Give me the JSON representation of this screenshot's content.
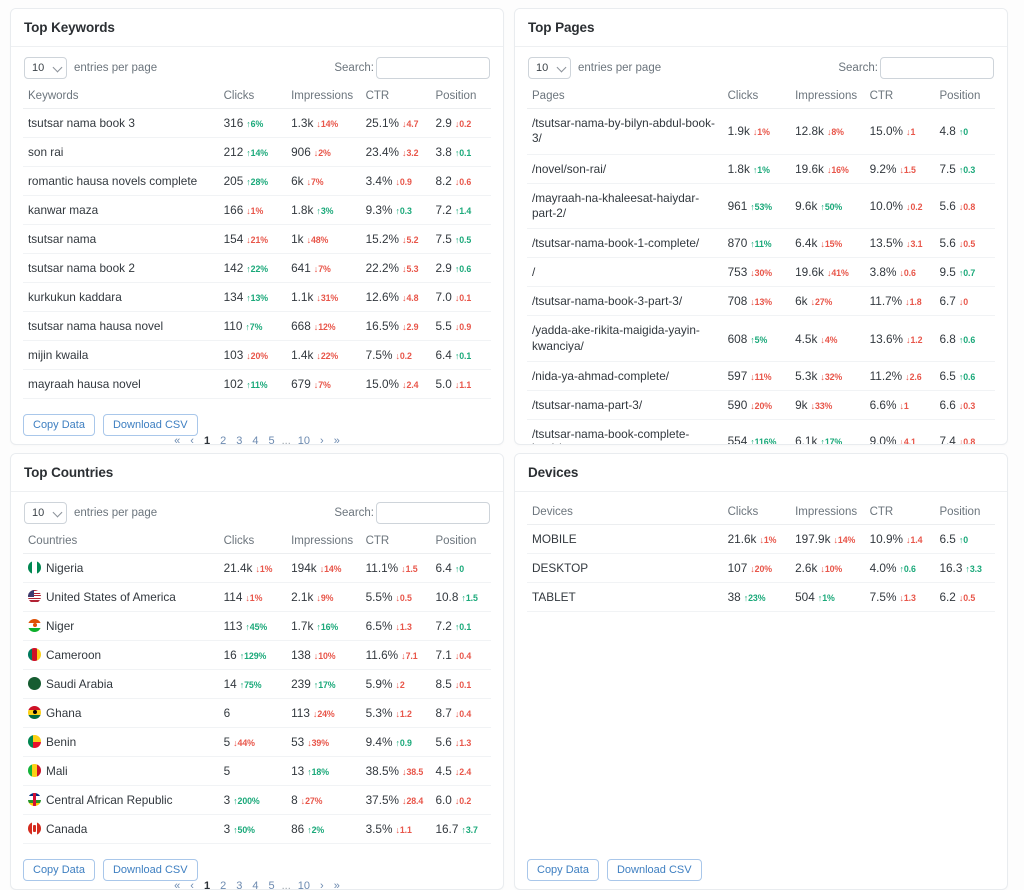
{
  "common": {
    "entries_label": "entries per page",
    "search_label": "Search:",
    "search_placeholder": "",
    "entries_value": "10",
    "entries_options": [
      "10",
      "25",
      "50",
      "100"
    ],
    "copy_label": "Copy Data",
    "download_label": "Download CSV",
    "pagination": [
      "«",
      "‹",
      "1",
      "2",
      "3",
      "4",
      "5",
      "...",
      "10",
      "›",
      "»"
    ],
    "pagination_active": "1",
    "colors": {
      "up": "#1ba97a",
      "down": "#e8564a",
      "link": "#3e7fc1",
      "text": "#32383e",
      "muted": "#6c757d",
      "border": "#e9ecef"
    }
  },
  "keywords_panel": {
    "title": "Top Keywords",
    "columns": [
      "Keywords",
      "Clicks",
      "Impressions",
      "CTR",
      "Position"
    ],
    "rows": [
      {
        "name": "tsutsar nama book 3",
        "clicks": "316",
        "clicks_d": "6%",
        "clicks_dir": "up",
        "impr": "1.3k",
        "impr_d": "14%",
        "impr_dir": "down",
        "ctr": "25.1%",
        "ctr_d": "4.7",
        "ctr_dir": "down",
        "pos": "2.9",
        "pos_d": "0.2",
        "pos_dir": "down"
      },
      {
        "name": "son rai",
        "clicks": "212",
        "clicks_d": "14%",
        "clicks_dir": "up",
        "impr": "906",
        "impr_d": "2%",
        "impr_dir": "down",
        "ctr": "23.4%",
        "ctr_d": "3.2",
        "ctr_dir": "down",
        "pos": "3.8",
        "pos_d": "0.1",
        "pos_dir": "up"
      },
      {
        "name": "romantic hausa novels complete",
        "clicks": "205",
        "clicks_d": "28%",
        "clicks_dir": "up",
        "impr": "6k",
        "impr_d": "7%",
        "impr_dir": "down",
        "ctr": "3.4%",
        "ctr_d": "0.9",
        "ctr_dir": "down",
        "pos": "8.2",
        "pos_d": "0.6",
        "pos_dir": "down"
      },
      {
        "name": "kanwar maza",
        "clicks": "166",
        "clicks_d": "1%",
        "clicks_dir": "down",
        "impr": "1.8k",
        "impr_d": "3%",
        "impr_dir": "up",
        "ctr": "9.3%",
        "ctr_d": "0.3",
        "ctr_dir": "up",
        "pos": "7.2",
        "pos_d": "1.4",
        "pos_dir": "up"
      },
      {
        "name": "tsutsar nama",
        "clicks": "154",
        "clicks_d": "21%",
        "clicks_dir": "down",
        "impr": "1k",
        "impr_d": "48%",
        "impr_dir": "down",
        "ctr": "15.2%",
        "ctr_d": "5.2",
        "ctr_dir": "down",
        "pos": "7.5",
        "pos_d": "0.5",
        "pos_dir": "up"
      },
      {
        "name": "tsutsar nama book 2",
        "clicks": "142",
        "clicks_d": "22%",
        "clicks_dir": "up",
        "impr": "641",
        "impr_d": "7%",
        "impr_dir": "down",
        "ctr": "22.2%",
        "ctr_d": "5.3",
        "ctr_dir": "down",
        "pos": "2.9",
        "pos_d": "0.6",
        "pos_dir": "up"
      },
      {
        "name": "kurkukun kaddara",
        "clicks": "134",
        "clicks_d": "13%",
        "clicks_dir": "up",
        "impr": "1.1k",
        "impr_d": "31%",
        "impr_dir": "down",
        "ctr": "12.6%",
        "ctr_d": "4.8",
        "ctr_dir": "down",
        "pos": "7.0",
        "pos_d": "0.1",
        "pos_dir": "down"
      },
      {
        "name": "tsutsar nama hausa novel",
        "clicks": "110",
        "clicks_d": "7%",
        "clicks_dir": "up",
        "impr": "668",
        "impr_d": "12%",
        "impr_dir": "down",
        "ctr": "16.5%",
        "ctr_d": "2.9",
        "ctr_dir": "down",
        "pos": "5.5",
        "pos_d": "0.9",
        "pos_dir": "down"
      },
      {
        "name": "mijin kwaila",
        "clicks": "103",
        "clicks_d": "20%",
        "clicks_dir": "down",
        "impr": "1.4k",
        "impr_d": "22%",
        "impr_dir": "down",
        "ctr": "7.5%",
        "ctr_d": "0.2",
        "ctr_dir": "down",
        "pos": "6.4",
        "pos_d": "0.1",
        "pos_dir": "up"
      },
      {
        "name": "mayraah hausa novel",
        "clicks": "102",
        "clicks_d": "11%",
        "clicks_dir": "up",
        "impr": "679",
        "impr_d": "7%",
        "impr_dir": "down",
        "ctr": "15.0%",
        "ctr_d": "2.4",
        "ctr_dir": "down",
        "pos": "5.0",
        "pos_d": "1.1",
        "pos_dir": "down"
      }
    ]
  },
  "pages_panel": {
    "title": "Top Pages",
    "columns": [
      "Pages",
      "Clicks",
      "Impressions",
      "CTR",
      "Position"
    ],
    "rows": [
      {
        "name": "/tsutsar-nama-by-bilyn-abdul-book-3/",
        "clicks": "1.9k",
        "clicks_d": "1%",
        "clicks_dir": "down",
        "impr": "12.8k",
        "impr_d": "8%",
        "impr_dir": "down",
        "ctr": "15.0%",
        "ctr_d": "1",
        "ctr_dir": "down",
        "pos": "4.8",
        "pos_d": "0",
        "pos_dir": "up"
      },
      {
        "name": "/novel/son-rai/",
        "clicks": "1.8k",
        "clicks_d": "1%",
        "clicks_dir": "up",
        "impr": "19.6k",
        "impr_d": "16%",
        "impr_dir": "down",
        "ctr": "9.2%",
        "ctr_d": "1.5",
        "ctr_dir": "down",
        "pos": "7.5",
        "pos_d": "0.3",
        "pos_dir": "up"
      },
      {
        "name": "/mayraah-na-khaleesat-haiydar-part-2/",
        "clicks": "961",
        "clicks_d": "53%",
        "clicks_dir": "up",
        "impr": "9.6k",
        "impr_d": "50%",
        "impr_dir": "up",
        "ctr": "10.0%",
        "ctr_d": "0.2",
        "ctr_dir": "down",
        "pos": "5.6",
        "pos_d": "0.8",
        "pos_dir": "down"
      },
      {
        "name": "/tsutsar-nama-book-1-complete/",
        "clicks": "870",
        "clicks_d": "11%",
        "clicks_dir": "up",
        "impr": "6.4k",
        "impr_d": "15%",
        "impr_dir": "down",
        "ctr": "13.5%",
        "ctr_d": "3.1",
        "ctr_dir": "down",
        "pos": "5.6",
        "pos_d": "0.5",
        "pos_dir": "down"
      },
      {
        "name": "/",
        "clicks": "753",
        "clicks_d": "30%",
        "clicks_dir": "down",
        "impr": "19.6k",
        "impr_d": "41%",
        "impr_dir": "down",
        "ctr": "3.8%",
        "ctr_d": "0.6",
        "ctr_dir": "down",
        "pos": "9.5",
        "pos_d": "0.7",
        "pos_dir": "up"
      },
      {
        "name": "/tsutsar-nama-book-3-part-3/",
        "clicks": "708",
        "clicks_d": "13%",
        "clicks_dir": "down",
        "impr": "6k",
        "impr_d": "27%",
        "impr_dir": "down",
        "ctr": "11.7%",
        "ctr_d": "1.8",
        "ctr_dir": "down",
        "pos": "6.7",
        "pos_d": "0",
        "pos_dir": "down"
      },
      {
        "name": "/yadda-ake-rikita-maigida-yayin-kwanciya/",
        "clicks": "608",
        "clicks_d": "5%",
        "clicks_dir": "up",
        "impr": "4.5k",
        "impr_d": "4%",
        "impr_dir": "down",
        "ctr": "13.6%",
        "ctr_d": "1.2",
        "ctr_dir": "down",
        "pos": "6.8",
        "pos_d": "0.6",
        "pos_dir": "up"
      },
      {
        "name": "/nida-ya-ahmad-complete/",
        "clicks": "597",
        "clicks_d": "11%",
        "clicks_dir": "down",
        "impr": "5.3k",
        "impr_d": "32%",
        "impr_dir": "down",
        "ctr": "11.2%",
        "ctr_d": "2.6",
        "ctr_dir": "down",
        "pos": "6.5",
        "pos_d": "0.6",
        "pos_dir": "up"
      },
      {
        "name": "/tsutsar-nama-part-3/",
        "clicks": "590",
        "clicks_d": "20%",
        "clicks_dir": "down",
        "impr": "9k",
        "impr_d": "33%",
        "impr_dir": "down",
        "ctr": "6.6%",
        "ctr_d": "1",
        "ctr_dir": "down",
        "pos": "6.6",
        "pos_d": "0.3",
        "pos_dir": "down"
      },
      {
        "name": "/tsutsar-nama-book-complete-book/",
        "clicks": "554",
        "clicks_d": "116%",
        "clicks_dir": "up",
        "impr": "6.1k",
        "impr_d": "17%",
        "impr_dir": "up",
        "ctr": "9.0%",
        "ctr_d": "4.1",
        "ctr_dir": "down",
        "pos": "7.4",
        "pos_d": "0.8",
        "pos_dir": "down"
      }
    ]
  },
  "countries_panel": {
    "title": "Top Countries",
    "columns": [
      "Countries",
      "Clicks",
      "Impressions",
      "CTR",
      "Position"
    ],
    "rows": [
      {
        "name": "Nigeria",
        "flag": "flag-nigeria",
        "clicks": "21.4k",
        "clicks_d": "1%",
        "clicks_dir": "down",
        "impr": "194k",
        "impr_d": "14%",
        "impr_dir": "down",
        "ctr": "11.1%",
        "ctr_d": "1.5",
        "ctr_dir": "down",
        "pos": "6.4",
        "pos_d": "0",
        "pos_dir": "up"
      },
      {
        "name": "United States of America",
        "flag": "flag-usa",
        "clicks": "114",
        "clicks_d": "1%",
        "clicks_dir": "down",
        "impr": "2.1k",
        "impr_d": "9%",
        "impr_dir": "down",
        "ctr": "5.5%",
        "ctr_d": "0.5",
        "ctr_dir": "down",
        "pos": "10.8",
        "pos_d": "1.5",
        "pos_dir": "up"
      },
      {
        "name": "Niger",
        "flag": "flag-niger",
        "clicks": "113",
        "clicks_d": "45%",
        "clicks_dir": "up",
        "impr": "1.7k",
        "impr_d": "16%",
        "impr_dir": "up",
        "ctr": "6.5%",
        "ctr_d": "1.3",
        "ctr_dir": "down",
        "pos": "7.2",
        "pos_d": "0.1",
        "pos_dir": "up"
      },
      {
        "name": "Cameroon",
        "flag": "flag-cameroon",
        "clicks": "16",
        "clicks_d": "129%",
        "clicks_dir": "up",
        "impr": "138",
        "impr_d": "10%",
        "impr_dir": "down",
        "ctr": "11.6%",
        "ctr_d": "7.1",
        "ctr_dir": "down",
        "pos": "7.1",
        "pos_d": "0.4",
        "pos_dir": "down"
      },
      {
        "name": "Saudi Arabia",
        "flag": "flag-saudi-arabia",
        "clicks": "14",
        "clicks_d": "75%",
        "clicks_dir": "up",
        "impr": "239",
        "impr_d": "17%",
        "impr_dir": "up",
        "ctr": "5.9%",
        "ctr_d": "2",
        "ctr_dir": "down",
        "pos": "8.5",
        "pos_d": "0.1",
        "pos_dir": "down"
      },
      {
        "name": "Ghana",
        "flag": "flag-ghana",
        "clicks": "6",
        "clicks_d": "",
        "clicks_dir": "",
        "impr": "113",
        "impr_d": "24%",
        "impr_dir": "down",
        "ctr": "5.3%",
        "ctr_d": "1.2",
        "ctr_dir": "down",
        "pos": "8.7",
        "pos_d": "0.4",
        "pos_dir": "down"
      },
      {
        "name": "Benin",
        "flag": "flag-benin",
        "clicks": "5",
        "clicks_d": "44%",
        "clicks_dir": "down",
        "impr": "53",
        "impr_d": "39%",
        "impr_dir": "down",
        "ctr": "9.4%",
        "ctr_d": "0.9",
        "ctr_dir": "up",
        "pos": "5.6",
        "pos_d": "1.3",
        "pos_dir": "down"
      },
      {
        "name": "Mali",
        "flag": "flag-mali",
        "clicks": "5",
        "clicks_d": "",
        "clicks_dir": "",
        "impr": "13",
        "impr_d": "18%",
        "impr_dir": "up",
        "ctr": "38.5%",
        "ctr_d": "38.5",
        "ctr_dir": "down",
        "pos": "4.5",
        "pos_d": "2.4",
        "pos_dir": "down"
      },
      {
        "name": "Central African Republic",
        "flag": "flag-central-african-republic",
        "clicks": "3",
        "clicks_d": "200%",
        "clicks_dir": "up",
        "impr": "8",
        "impr_d": "27%",
        "impr_dir": "down",
        "ctr": "37.5%",
        "ctr_d": "28.4",
        "ctr_dir": "down",
        "pos": "6.0",
        "pos_d": "0.2",
        "pos_dir": "down"
      },
      {
        "name": "Canada",
        "flag": "flag-canada",
        "clicks": "3",
        "clicks_d": "50%",
        "clicks_dir": "up",
        "impr": "86",
        "impr_d": "2%",
        "impr_dir": "up",
        "ctr": "3.5%",
        "ctr_d": "1.1",
        "ctr_dir": "down",
        "pos": "16.7",
        "pos_d": "3.7",
        "pos_dir": "up"
      }
    ]
  },
  "devices_panel": {
    "title": "Devices",
    "columns": [
      "Devices",
      "Clicks",
      "Impressions",
      "CTR",
      "Position"
    ],
    "rows": [
      {
        "name": "MOBILE",
        "clicks": "21.6k",
        "clicks_d": "1%",
        "clicks_dir": "down",
        "impr": "197.9k",
        "impr_d": "14%",
        "impr_dir": "down",
        "ctr": "10.9%",
        "ctr_d": "1.4",
        "ctr_dir": "down",
        "pos": "6.5",
        "pos_d": "0",
        "pos_dir": "up"
      },
      {
        "name": "DESKTOP",
        "clicks": "107",
        "clicks_d": "20%",
        "clicks_dir": "down",
        "impr": "2.6k",
        "impr_d": "10%",
        "impr_dir": "down",
        "ctr": "4.0%",
        "ctr_d": "0.6",
        "ctr_dir": "up",
        "pos": "16.3",
        "pos_d": "3.3",
        "pos_dir": "up"
      },
      {
        "name": "TABLET",
        "clicks": "38",
        "clicks_d": "23%",
        "clicks_dir": "up",
        "impr": "504",
        "impr_d": "1%",
        "impr_dir": "up",
        "ctr": "7.5%",
        "ctr_d": "1.3",
        "ctr_dir": "down",
        "pos": "6.2",
        "pos_d": "0.5",
        "pos_dir": "down"
      }
    ]
  }
}
